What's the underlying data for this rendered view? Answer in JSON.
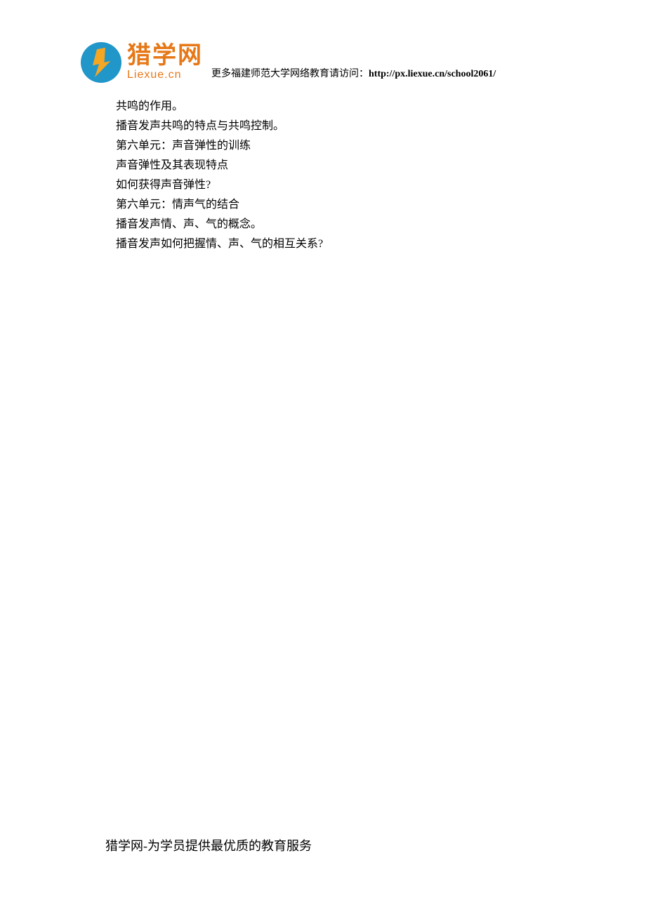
{
  "header": {
    "logo_cn": "猎学网",
    "logo_en": "Liexue.cn",
    "link_prefix": "更多福建师范大学网络教育请访问：",
    "link_url": "http://px.liexue.cn/school2061/"
  },
  "content": {
    "lines": [
      "共鸣的作用。",
      "播音发声共鸣的特点与共鸣控制。",
      "第六单元：声音弹性的训练",
      "声音弹性及其表现特点",
      "如何获得声音弹性?",
      "第六单元：情声气的结合",
      "播音发声情、声、气的概念。",
      "播音发声如何把握情、声、气的相互关系?"
    ]
  },
  "footer": {
    "text": "猎学网-为学员提供最优质的教育服务"
  }
}
